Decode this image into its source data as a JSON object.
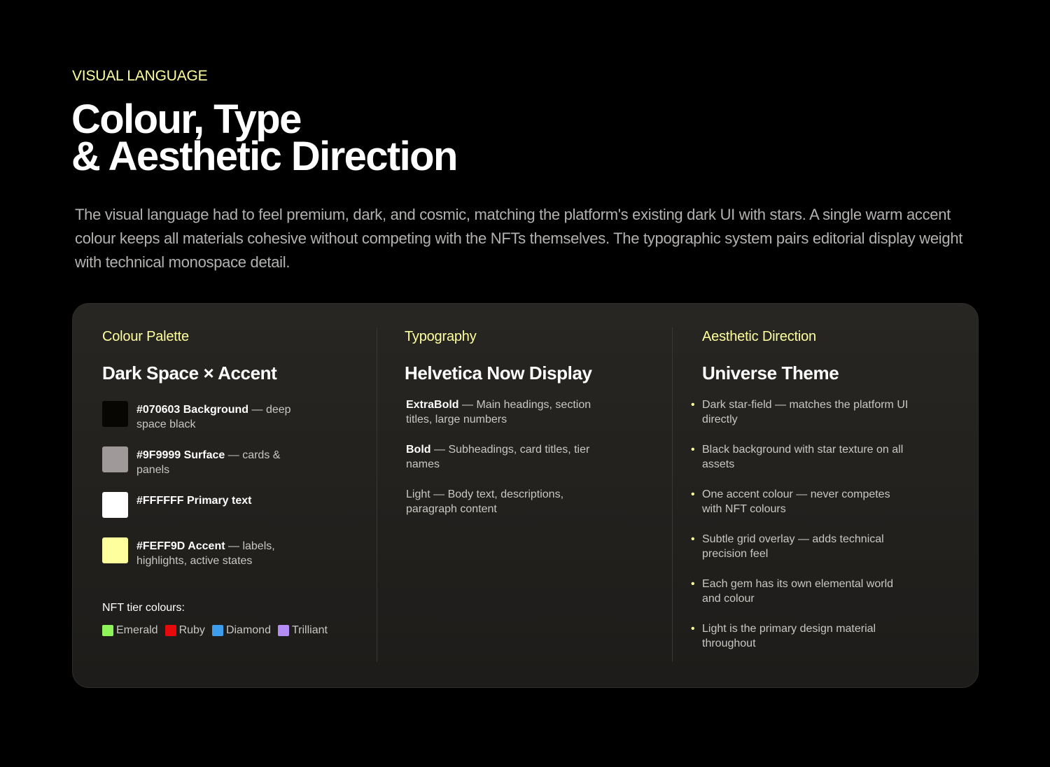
{
  "header": {
    "eyebrow": "VISUAL LANGUAGE",
    "title_line1": "Colour, Type",
    "title_line2": "& Aesthetic Direction",
    "intro": "The visual language had to feel premium, dark, and cosmic, matching the platform's existing dark UI with stars. A single warm accent colour keeps all materials cohesive without competing with the NFTs themselves. The typographic system pairs editorial display weight with technical monospace detail."
  },
  "palette": {
    "label": "Colour Palette",
    "title": "Dark Space × Accent",
    "swatches": [
      {
        "name": "#070603 Background",
        "desc": " — deep space black",
        "color": "#070603"
      },
      {
        "name": "#9F9999 Surface",
        "desc": " — cards & panels",
        "color": "#9F9999"
      },
      {
        "name": "#FFFFFF Primary text",
        "desc": "",
        "color": "#FFFFFF"
      },
      {
        "name": "#FEFF9D Accent",
        "desc": " — labels, highlights, active states",
        "color": "#FEFF9D"
      }
    ],
    "tier_label": "NFT tier colours:",
    "tiers": [
      {
        "name": "Emerald",
        "color": "#8EF45A"
      },
      {
        "name": "Ruby",
        "color": "#E8090C"
      },
      {
        "name": "Diamond",
        "color": "#3D9CEB"
      },
      {
        "name": "Trilliant",
        "color": "#B48CF5"
      }
    ]
  },
  "typography": {
    "label": "Typography",
    "title": "Helvetica Now Display",
    "items": [
      {
        "weight": "ExtraBold",
        "desc": " — Main headings, section titles, large numbers",
        "bold": true
      },
      {
        "weight": "Bold",
        "desc": " — Subheadings, card titles, tier names",
        "bold": true
      },
      {
        "weight": "Light",
        "desc": " — Body text, descriptions, paragraph content",
        "bold": false
      }
    ]
  },
  "aesthetic": {
    "label": "Aesthetic Direction",
    "title": "Universe Theme",
    "bullet": "•",
    "items": [
      "Dark star-field — matches the platform UI directly",
      "Black background with star texture on all assets",
      "One accent colour — never competes with NFT colours",
      "Subtle grid overlay — adds technical precision feel",
      "Each gem has its own elemental world and colour",
      "Light is the primary design material throughout"
    ]
  }
}
